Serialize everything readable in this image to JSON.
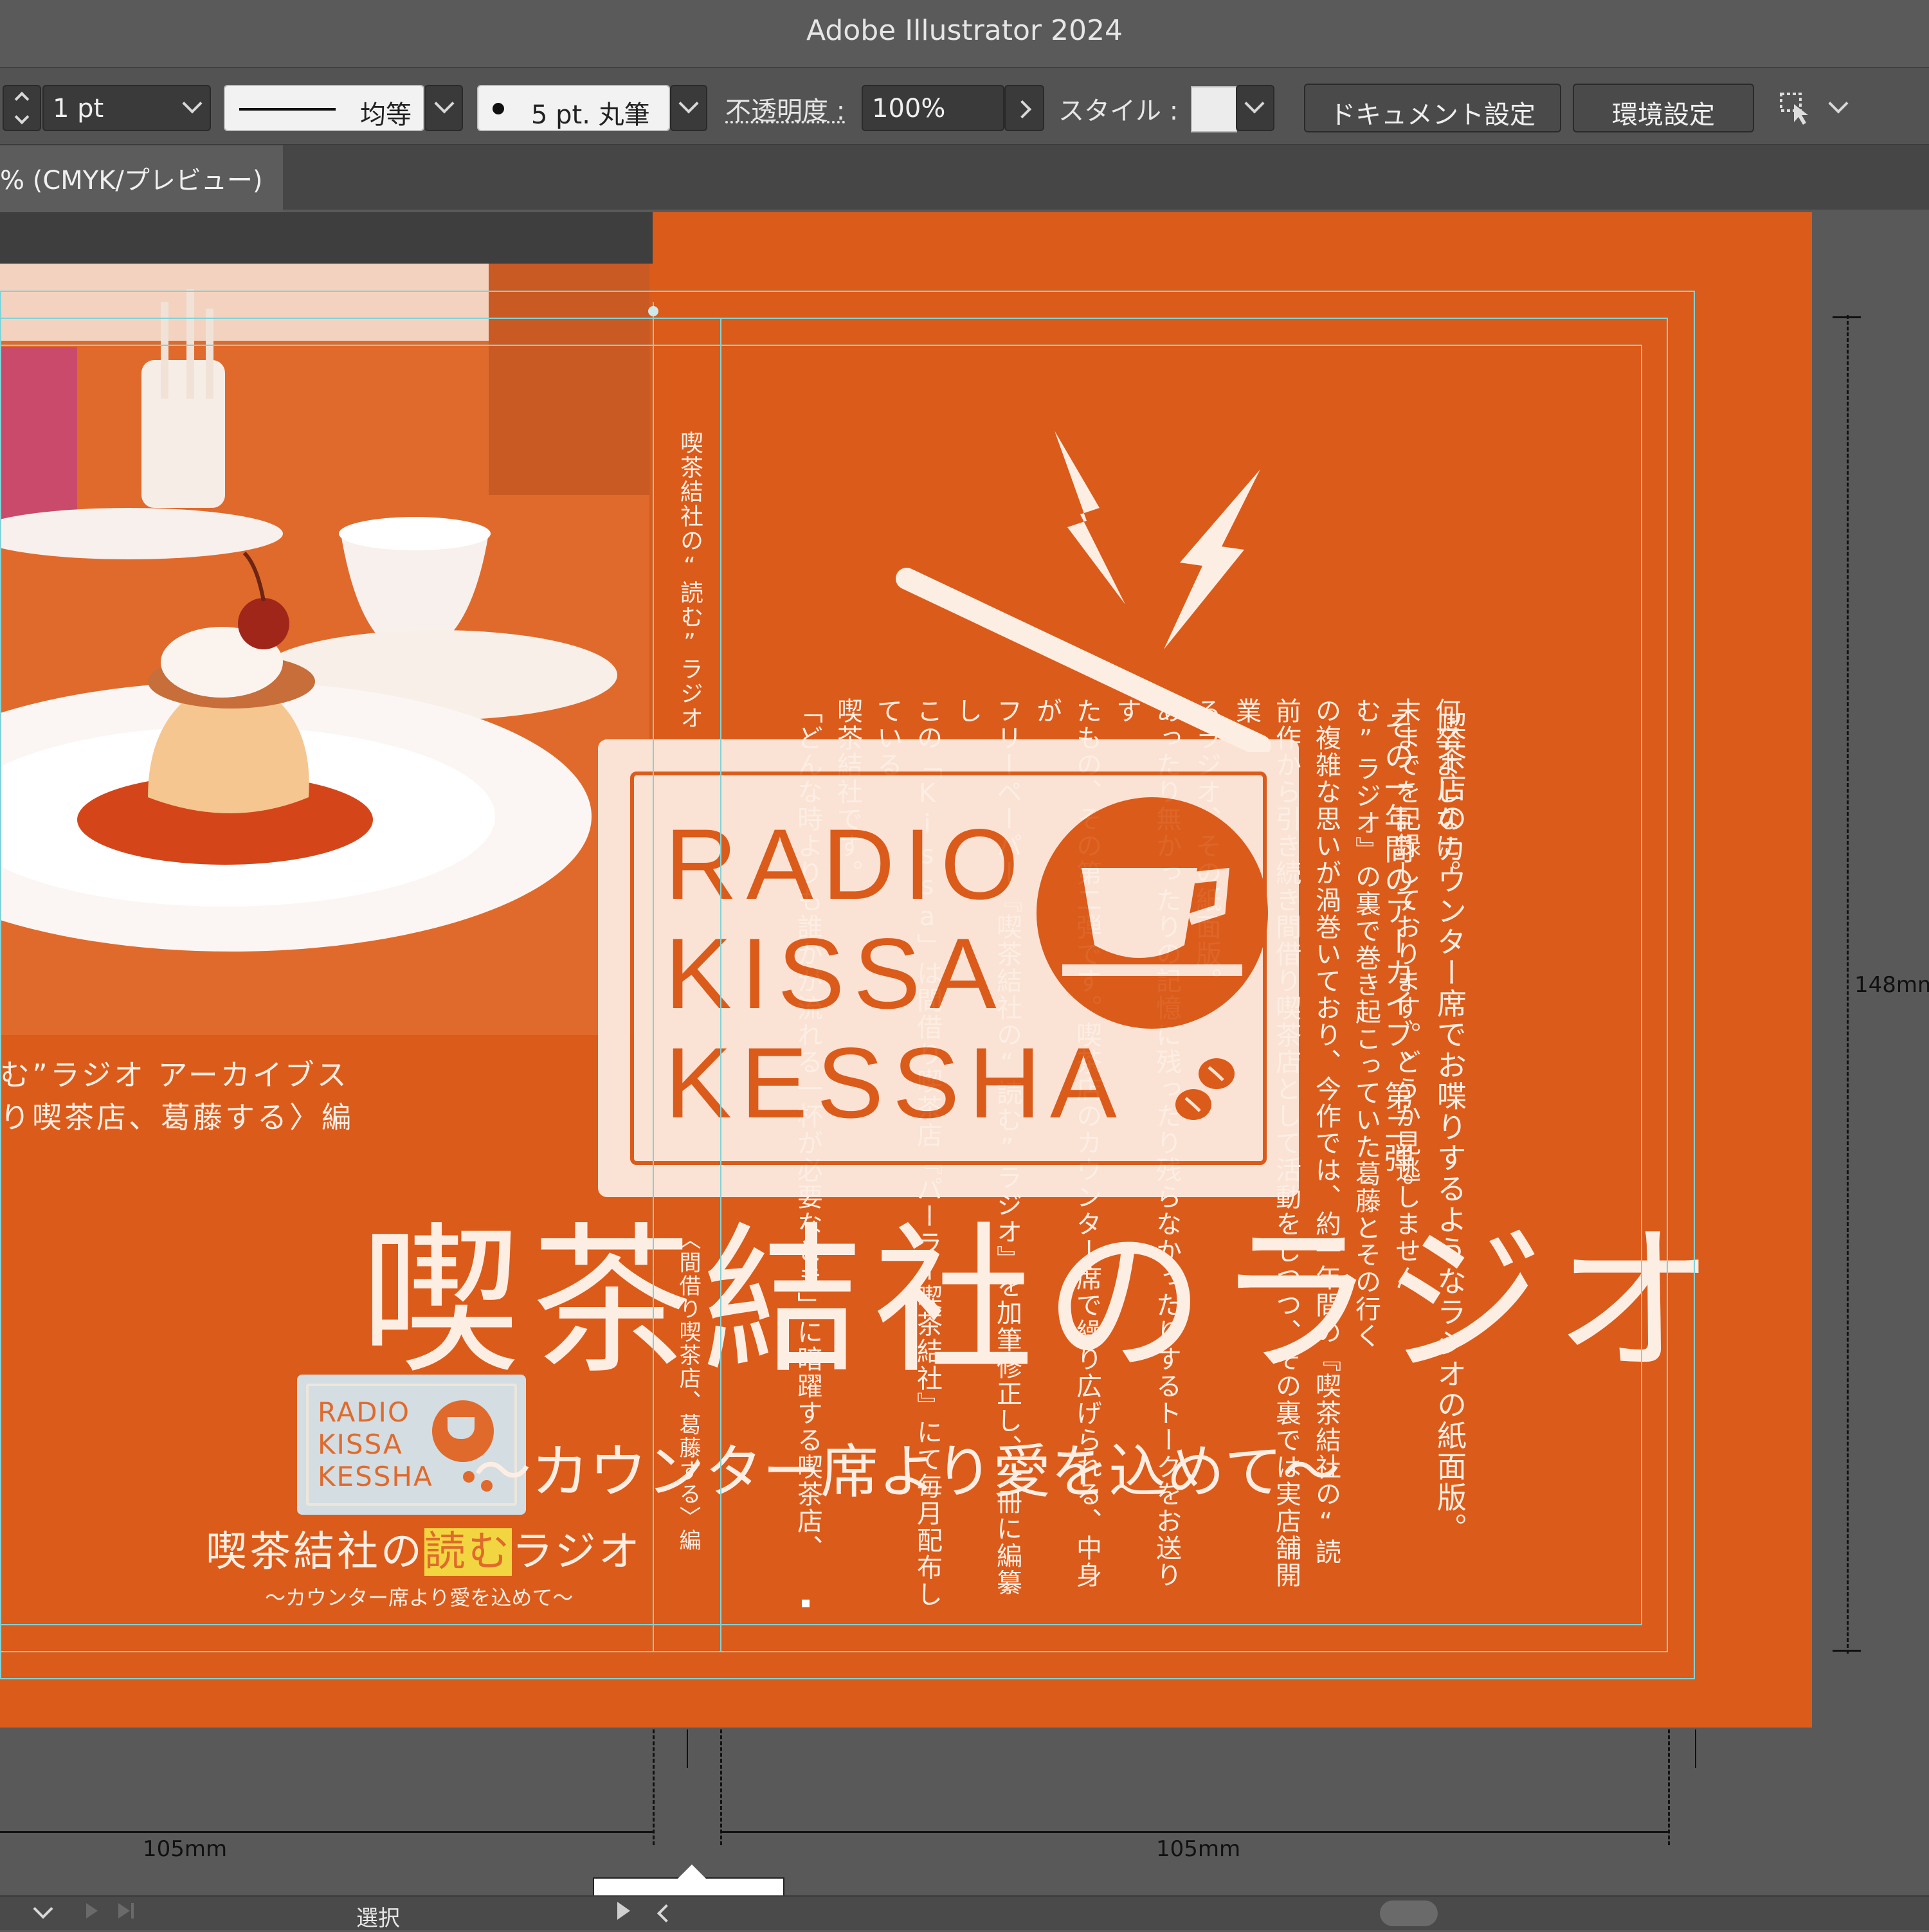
{
  "app": {
    "title": "Adobe Illustrator 2024"
  },
  "control_bar": {
    "stroke_weight": "1 pt",
    "stroke_profile": "均等",
    "brush": "5 pt. 丸筆",
    "opacity_label": "不透明度 :",
    "opacity_value": "100%",
    "style_label": "スタイル :",
    "document_setup_label": "ドキュメント設定",
    "preferences_label": "環境設定"
  },
  "document_tab": {
    "label": "% (CMYK/プレビュー)"
  },
  "back_cover": {
    "caption_line1": "む”ラジオ アーカイブス",
    "caption_line2": "り喫茶店、葛藤する〉編",
    "small_logo_lines": [
      "RADIO",
      "KISSA",
      "KESSHA"
    ],
    "small_title_pre": "喫茶結社の",
    "small_title_highlight": "読む",
    "small_title_post": "ラジオ",
    "small_subtitle": "〜カウンター席より愛を込めて〜"
  },
  "spine": {
    "text_top": "喫茶結社の“読む”ラジオ",
    "text_bottom": "〈間借り喫茶店、葛藤する〉編"
  },
  "front_cover": {
    "logo_lines": [
      "RADIO",
      "KISSA",
      "KESSHA"
    ],
    "title": "喫茶結社のラジオ",
    "subtitle": "〜カウンター席より愛を込めて〜",
    "vertical_columns": [
      "喫茶店のカウンター席でお喋りするようなラジオの紙面版。",
      "その一年間のアーカイブ、第二弾。",
      "「どんな時よりも誰かが流れる一杯が必要なとき」に暗躍する喫茶店、",
      "喫茶結社です。",
      "この「Kissa」は間借り喫茶店『パーラー喫茶結社』にて毎月配布している",
      "フリーペーパー『喫茶結社の“読む”ラジオ』を加筆修正し、一冊に編纂し",
      "たもの、その第二弾です。喫茶店のカウンター席で繰り広げられる、中身が",
      "あったり無かったりの記憶に残ったり残らなかったりするトークをお送りす",
      "るラジオ、その紙面版。",
      "前作から引き続き間借り喫茶店として活動をしつつ、その裏では実店舗開業へ",
      "の複雑な思いが渦巻いており、今作では、約一年間の『喫茶結社の“読",
      "む”ラジオ』の裏で巻き起こっていた葛藤とその行く",
      "末までを記録しております。どうか見逃しません",
      "何卒よしなに。"
    ]
  },
  "dimensions": {
    "left_width": "105mm",
    "right_width": "105mm",
    "height": "148mm"
  },
  "status_bar": {
    "tool": "選択"
  },
  "colors": {
    "cover_orange": "#db5b1a",
    "cream": "#fdeee4",
    "guide_cyan": "#7fd3d8"
  }
}
